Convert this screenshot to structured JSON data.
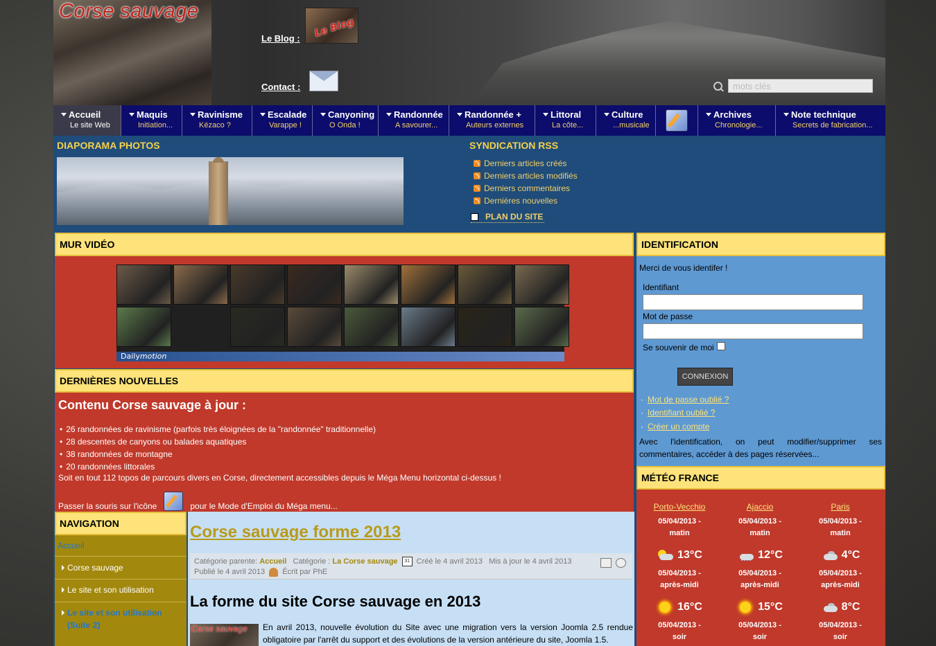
{
  "header": {
    "logo": "Corse sauvage",
    "blog_label": "Le Blog :",
    "blog_thumb_text": "Le Blog",
    "contact_label": "Contact :",
    "search_placeholder": "mots clés"
  },
  "menu": [
    {
      "label": "Accueil",
      "sub": "Le site Web"
    },
    {
      "label": "Maquis",
      "sub": "Initiation..."
    },
    {
      "label": "Ravinisme",
      "sub": "Kézaco ?"
    },
    {
      "label": "Escalade",
      "sub": "Varappe !"
    },
    {
      "label": "Canyoning",
      "sub": "O Onda !"
    },
    {
      "label": "Randonnée",
      "sub": "A savourer..."
    },
    {
      "label": "Randonnée +",
      "sub": "Auteurs externes"
    },
    {
      "label": "Littoral",
      "sub": "La côte..."
    },
    {
      "label": "Culture",
      "sub": "...musicale"
    },
    {
      "label": "Archives",
      "sub": "Chronologie..."
    },
    {
      "label": "Note technique",
      "sub": "Secrets de fabrication..."
    }
  ],
  "diaporama": {
    "title": "DIAPORAMA PHOTOS"
  },
  "rss": {
    "title": "SYNDICATION RSS",
    "items": [
      "Derniers articles créés",
      "Derniers articles modifiés",
      "Derniers commentaires",
      "Dernières nouvelles"
    ],
    "sitemap": "PLAN DU SITE"
  },
  "video_wall": {
    "title": "MUR VIDÉO",
    "brand_prefix": "Daily",
    "brand_suffix": "motion",
    "thumb_colors": [
      "#6b5a48",
      "#8a6a4a",
      "#4a3a2a",
      "#3a2a20",
      "#9a8a6a",
      "#a0703a",
      "#6a5a3a",
      "#7a6a50",
      "#5a7a4a",
      "#2a2a22",
      "#5a4a3a",
      "#4a5a3a",
      "#6a7a8a",
      "#2a2418",
      "#5a6a4a"
    ]
  },
  "news": {
    "title": "DERNIÈRES NOUVELLES",
    "headline": "Contenu Corse sauvage à jour :",
    "items": [
      "26 randonnées de ravinisme (parfois très éloignées de la \"randonnée\" traditionnelle)",
      "28 descentes de canyons ou balades aquatiques",
      "38 randonnées de montagne",
      "20 randonnées littorales"
    ],
    "total": "Soit en tout 112 topos de parcours divers en Corse, directement accessibles depuis le Méga Menu horizontal ci-dessus !",
    "hover_before": "Passer la souris sur l'icône",
    "hover_after": "pour le Mode d'Emploi du Méga menu..."
  },
  "navigation": {
    "title": "NAVIGATION",
    "home": "Accueil",
    "items": [
      "Corse sauvage",
      "Le site et son utilisation",
      "Le site et son utilisation (Suite 2)"
    ]
  },
  "article": {
    "title": "Corse sauvage forme 2013",
    "parent_label": "Catégorie parente:",
    "parent_link": "Accueil",
    "category_label": "Catégorie :",
    "category_link": "La Corse sauvage",
    "calendar_day": "31",
    "created": "Créé le 4 avril 2013",
    "updated": "Mis à jour le 4 avril 2013",
    "published": "Publié le 4 avril 2013",
    "author": "Écrit par PhE",
    "heading": "La forme du site Corse sauvage en 2013",
    "thumb_text": "Corse sauvage",
    "text": "En avril 2013, nouvelle évolution du Site avec une migration vers la version Joomla 2.5 rendue obligatoire par l'arrêt du support et des évolutions de la version antérieure du site, Joomla 1.5."
  },
  "identification": {
    "title": "IDENTIFICATION",
    "intro": "Merci de vous identifer !",
    "username_label": "Identifiant",
    "password_label": "Mot de passe",
    "remember_label": "Se souvenir de moi",
    "login_button": "CONNEXION",
    "forgot_password": "Mot de passe oublié ?",
    "forgot_username": "Identifiant oublié ?",
    "create_account": "Créer un compte",
    "note": "Avec l'identification, on peut modifier/supprimer ses commentaires, accéder à des pages réservées..."
  },
  "meteo": {
    "title": "MÉTÉO FRANCE",
    "cities": [
      {
        "name": "Porto-Vecchio",
        "slots": [
          {
            "date": "05/04/2013 -",
            "period": "matin",
            "temp": "13°C",
            "icon": "cloud-sun"
          },
          {
            "date": "05/04/2013 -",
            "period": "après-midi",
            "temp": "16°C",
            "icon": "sun"
          },
          {
            "date": "05/04/2013 -",
            "period": "soir",
            "temp": "",
            "icon": ""
          }
        ]
      },
      {
        "name": "Ajaccio",
        "slots": [
          {
            "date": "05/04/2013 -",
            "period": "matin",
            "temp": "12°C",
            "icon": "rain"
          },
          {
            "date": "05/04/2013 -",
            "period": "après-midi",
            "temp": "15°C",
            "icon": "sun"
          },
          {
            "date": "05/04/2013 -",
            "period": "soir",
            "temp": "",
            "icon": ""
          }
        ]
      },
      {
        "name": "Paris",
        "slots": [
          {
            "date": "05/04/2013 -",
            "period": "matin",
            "temp": "4°C",
            "icon": "cloud"
          },
          {
            "date": "05/04/2013 -",
            "period": "après-midi",
            "temp": "8°C",
            "icon": "cloud"
          },
          {
            "date": "05/04/2013 -",
            "period": "soir",
            "temp": "",
            "icon": ""
          }
        ]
      }
    ]
  }
}
